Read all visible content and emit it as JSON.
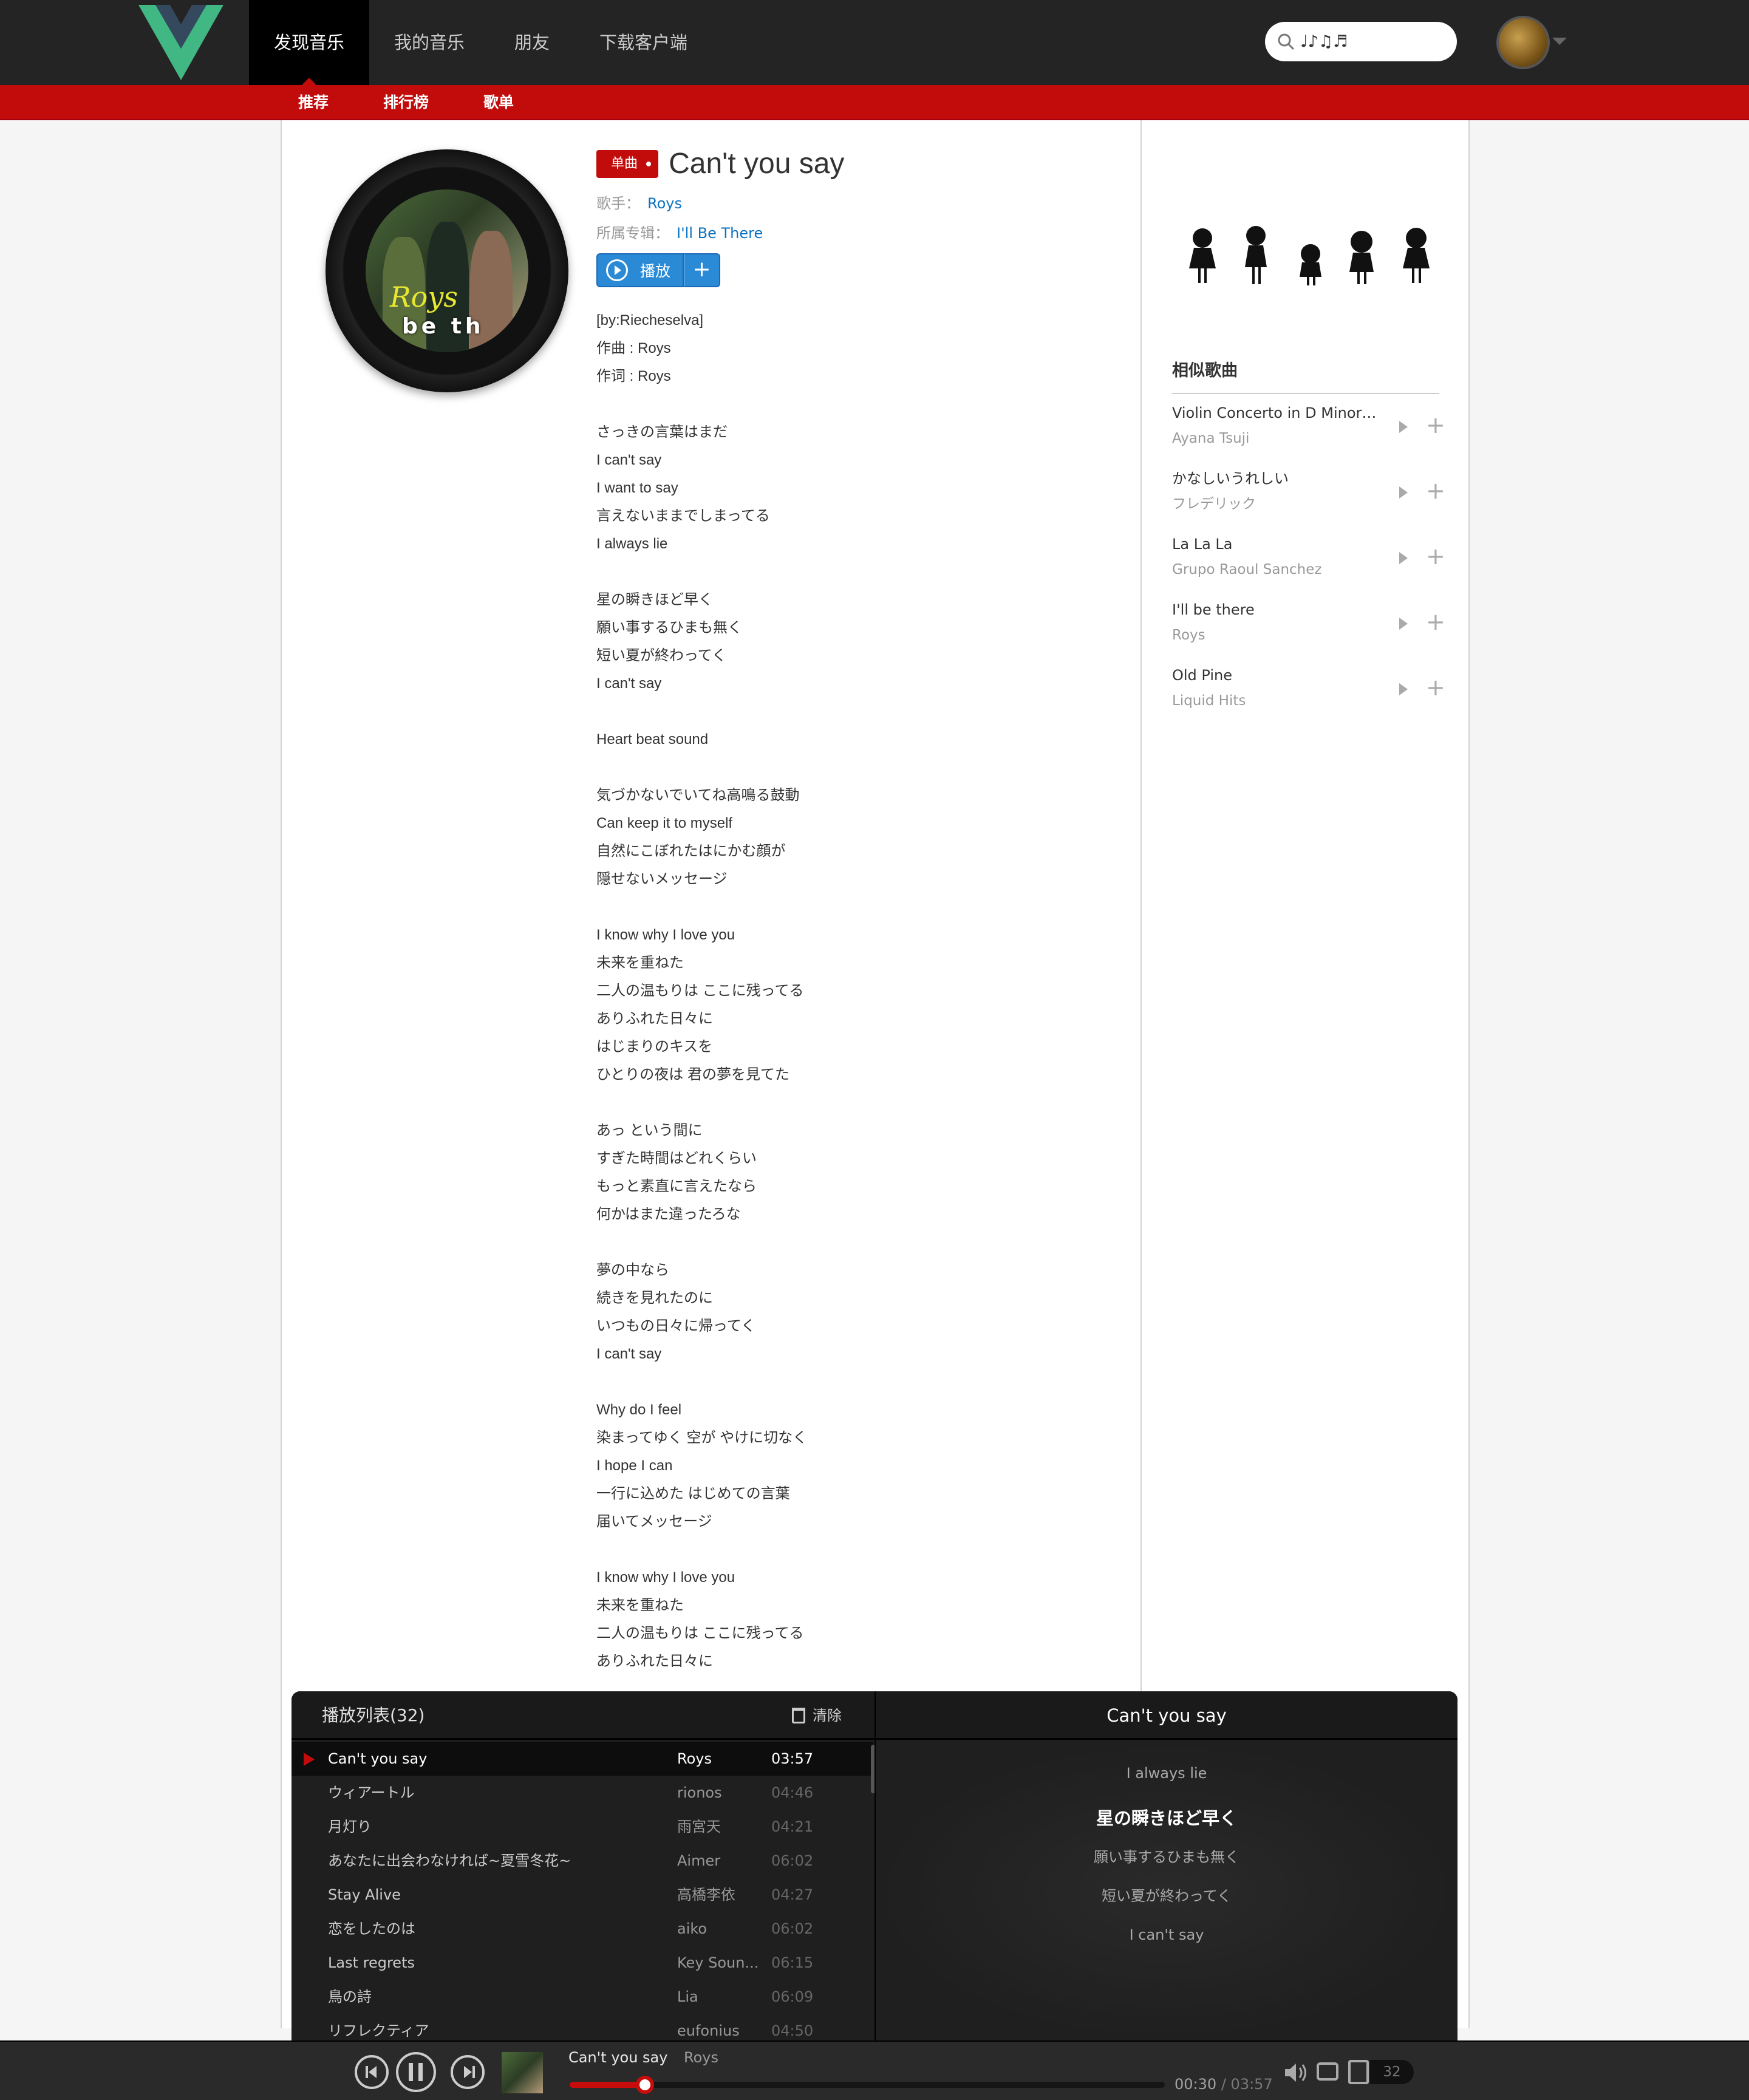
{
  "nav": {
    "items": [
      "发现音乐",
      "我的音乐",
      "朋友",
      "下载客户端"
    ]
  },
  "search": {
    "value": "♩♪♫♬"
  },
  "subnav": {
    "items": [
      "推荐",
      "排行榜",
      "歌单"
    ]
  },
  "song": {
    "tag": "单曲",
    "title": "Can't you say",
    "artist_label": "歌手：",
    "artist": "Roys",
    "album_label": "所属专辑：",
    "album": "I'll Be There",
    "play_label": "播放",
    "add_label": "+",
    "cover_text": "Roys",
    "cover_subtext": "be th"
  },
  "lyrics": [
    "[by:Riecheselva]",
    "作曲 : Roys",
    "作词 : Roys",
    "",
    "さっきの言葉はまだ",
    "I can't say",
    "I want to say",
    "言えないままでしまってる",
    "I always lie",
    "",
    "星の瞬きほど早く",
    "願い事するひまも無く",
    "短い夏が終わってく",
    "I can't say",
    "",
    "Heart beat sound",
    "",
    "気づかないでいてね高鳴る鼓動",
    "Can keep it to myself",
    "自然にこぼれたはにかむ顔が",
    "隠せないメッセージ",
    "",
    "I know why I love you",
    "未来を重ねた",
    "二人の温もりは ここに残ってる",
    "ありふれた日々に",
    "はじまりのキスを",
    "ひとりの夜は 君の夢を見てた",
    "",
    "あっ という間に",
    "すぎた時間はどれくらい",
    "もっと素直に言えたなら",
    "何かはまた違ったろな",
    "",
    "夢の中なら",
    "続きを見れたのに",
    "いつもの日々に帰ってく",
    "I can't say",
    "",
    "Why do I feel",
    "染まってゆく 空が やけに切なく",
    "I hope I can",
    "一行に込めた はじめての言葉",
    "届いてメッセージ",
    "",
    "I know why I love you",
    "未来を重ねた",
    "二人の温もりは ここに残ってる",
    "ありふれた日々に"
  ],
  "similar": {
    "title": "相似歌曲",
    "items": [
      {
        "name": "Violin Concerto in D Minor,...",
        "artist": "Ayana Tsuji"
      },
      {
        "name": "かなしいうれしい",
        "artist": "フレデリック"
      },
      {
        "name": "La La La",
        "artist": "Grupo Raoul Sanchez"
      },
      {
        "name": "I'll be there",
        "artist": "Roys"
      },
      {
        "name": "Old Pine",
        "artist": "Liquid Hits"
      }
    ]
  },
  "playlist": {
    "title": "播放列表(32)",
    "clear_label": "清除",
    "now_title": "Can't you say",
    "rows": [
      {
        "name": "Can't you say",
        "artist": "Roys",
        "time": "03:57"
      },
      {
        "name": "ウィアートル",
        "artist": "rionos",
        "time": "04:46"
      },
      {
        "name": "月灯り",
        "artist": "雨宮天",
        "time": "04:21"
      },
      {
        "name": "あなたに出会わなければ~夏雪冬花~",
        "artist": "Aimer",
        "time": "06:02"
      },
      {
        "name": "Stay Alive",
        "artist": "高橋李依",
        "time": "04:27"
      },
      {
        "name": "恋をしたのは",
        "artist": "aiko",
        "time": "06:02"
      },
      {
        "name": "Last regrets",
        "artist": "Key Soun...",
        "time": "06:15"
      },
      {
        "name": "鳥の詩",
        "artist": "Lia",
        "time": "06:09"
      },
      {
        "name": "リフレクティア",
        "artist": "eufonius",
        "time": "04:50"
      }
    ],
    "lyric_lines": [
      "I always lie",
      "",
      "星の瞬きほど早く",
      "願い事するひまも無く",
      "短い夏が終わってく",
      "I can't say"
    ],
    "current_lyric": "星の瞬きほど早く"
  },
  "player": {
    "song": "Can't you say",
    "artist": "Roys",
    "current_time": "00:30",
    "sep": "/",
    "total_time": "03:57",
    "progress": 0.1266,
    "count": "32"
  },
  "colors": {
    "accent": "#c20c0c",
    "link": "#0c73c2",
    "button": "#2b8ad6"
  }
}
